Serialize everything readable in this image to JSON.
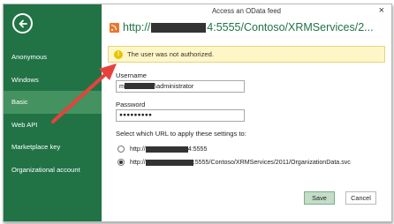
{
  "window": {
    "title": "Access an OData feed",
    "close_glyph": "×"
  },
  "sidebar": {
    "color": "#217346",
    "active_color": "#43925f",
    "items": [
      {
        "label": "Anonymous",
        "active": false
      },
      {
        "label": "Windows",
        "active": false
      },
      {
        "label": "Basic",
        "active": true
      },
      {
        "label": "Web API",
        "active": false
      },
      {
        "label": "Marketplace key",
        "active": false
      },
      {
        "label": "Organizational account",
        "active": false
      }
    ]
  },
  "main": {
    "url_prefix": "http://",
    "url_suffix": "4:5555/Contoso/XRMServices/2...",
    "warning": "The user was not authorized.",
    "username_label": "Username",
    "username_value_prefix": "m",
    "username_value_suffix": "\\administrator",
    "password_label": "Password",
    "password_value": "●●●●●●●●●",
    "scope_label": "Select which URL to apply these settings to:",
    "scope_options": [
      {
        "prefix": "http://",
        "suffix": "4:5555",
        "selected": false
      },
      {
        "prefix": "http://",
        "suffix": ":5555/Contoso/XRMServices/2011/OrganizationData.svc",
        "selected": true
      }
    ],
    "save_label": "Save",
    "cancel_label": "Cancel"
  },
  "annotation": {
    "color": "#e8413c"
  }
}
